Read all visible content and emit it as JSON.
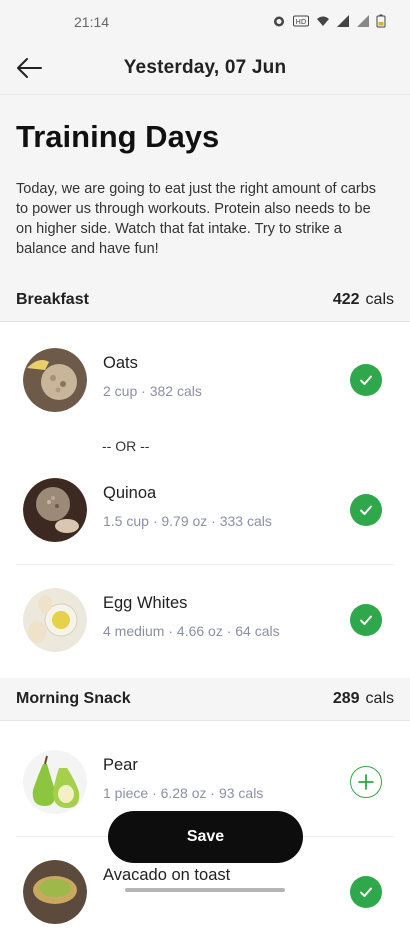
{
  "status_bar": {
    "time": "21:14"
  },
  "header": {
    "title": "Yesterday, 07 Jun"
  },
  "intro": {
    "title": "Training Days",
    "description": "Today, we are going to eat just the right amount of carbs to power us through workouts. Protein also needs to be on higher side. Watch that fat intake. Try to strike a balance and have fun!"
  },
  "sections": [
    {
      "name": "Breakfast",
      "cals_value": "422",
      "cals_unit": "cals",
      "or_label": "-- OR --",
      "items": [
        {
          "name": "Oats",
          "meta": "2 cup · 382 cals",
          "state": "checked"
        },
        {
          "name": "Quinoa",
          "meta": "1.5 cup · 9.79 oz · 333 cals",
          "state": "checked"
        },
        {
          "name": "Egg Whites",
          "meta": "4 medium · 4.66 oz · 64 cals",
          "state": "checked"
        }
      ]
    },
    {
      "name": "Morning Snack",
      "cals_value": "289",
      "cals_unit": "cals",
      "items": [
        {
          "name": "Pear",
          "meta": "1 piece · 6.28 oz · 93 cals",
          "state": "add"
        },
        {
          "name": "Avacado on toast",
          "meta": "",
          "state": "checked"
        }
      ]
    }
  ],
  "actions": {
    "save_label": "Save"
  },
  "colors": {
    "accent_green": "#2ea84a",
    "button_black": "#0d0d0d",
    "meta_text": "#8a8fa8"
  }
}
